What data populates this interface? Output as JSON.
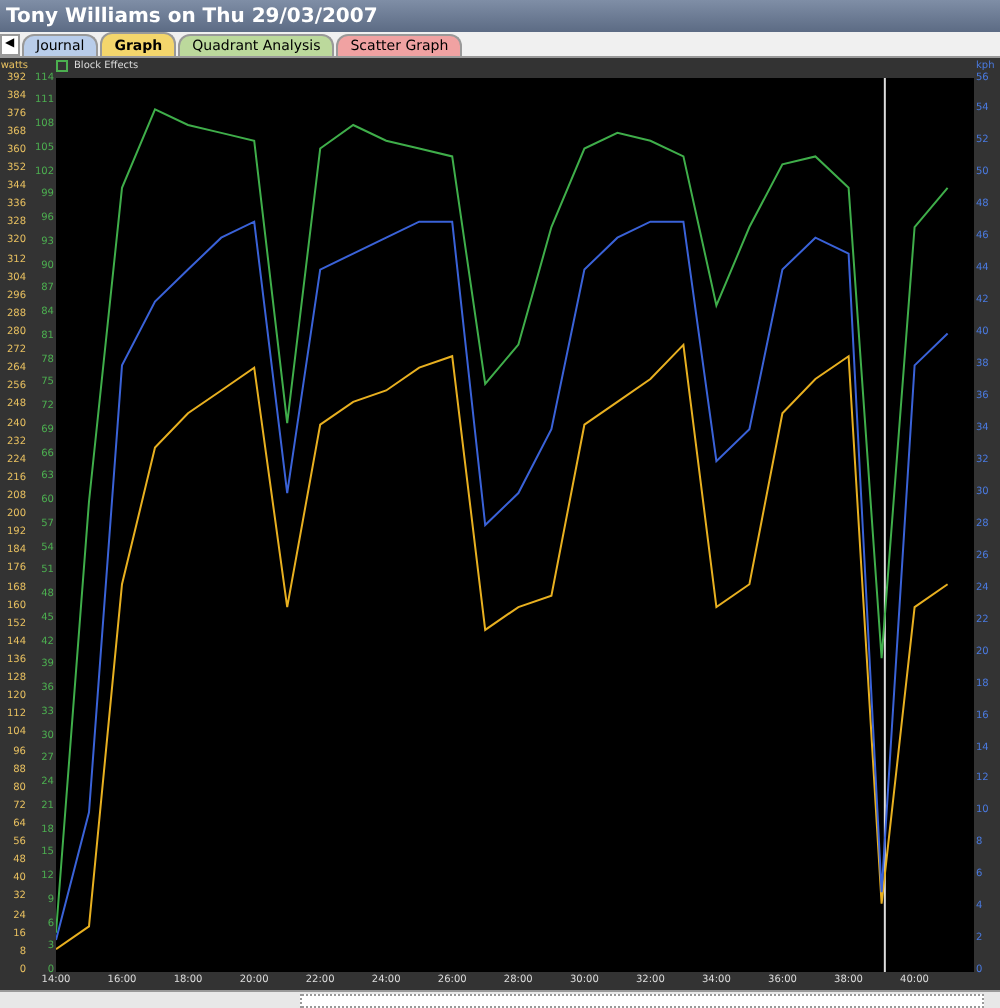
{
  "window": {
    "title": "Tony Williams on Thu 29/03/2007"
  },
  "nav_button": "◀",
  "tabs": [
    {
      "label": "Journal",
      "selected": false,
      "color": "#b9cdea"
    },
    {
      "label": "Graph",
      "selected": true,
      "color": "#f4d66c"
    },
    {
      "label": "Quadrant Analysis",
      "selected": false,
      "color": "#bcd99c"
    },
    {
      "label": "Scatter Graph",
      "selected": false,
      "color": "#f0a2a2"
    }
  ],
  "legend": {
    "label": "Block Effects"
  },
  "chart_data": {
    "type": "line",
    "ylabel": "watts",
    "y3label": "kph",
    "xlim": [
      14,
      41.8
    ],
    "ylim": [
      0,
      392
    ],
    "y2lim": [
      0,
      114
    ],
    "y3lim": [
      0,
      56
    ],
    "yticks": [
      392,
      384,
      376,
      368,
      360,
      352,
      344,
      336,
      328,
      320,
      312,
      304,
      296,
      288,
      280,
      272,
      264,
      256,
      248,
      240,
      232,
      224,
      216,
      208,
      200,
      192,
      184,
      176,
      168,
      160,
      152,
      144,
      136,
      128,
      120,
      112,
      104,
      96,
      88,
      80,
      72,
      64,
      56,
      48,
      40,
      32,
      24,
      16,
      8,
      0
    ],
    "y2ticks": [
      114,
      111,
      108,
      105,
      102,
      99,
      96,
      93,
      90,
      87,
      84,
      81,
      78,
      75,
      72,
      69,
      66,
      63,
      60,
      57,
      54,
      51,
      48,
      45,
      42,
      39,
      36,
      33,
      30,
      27,
      24,
      21,
      18,
      15,
      12,
      9,
      6,
      3,
      0
    ],
    "y3ticks": [
      56,
      54,
      52,
      50,
      48,
      46,
      44,
      42,
      40,
      38,
      36,
      34,
      32,
      30,
      28,
      26,
      24,
      22,
      20,
      18,
      16,
      14,
      12,
      10,
      8,
      6,
      4,
      2,
      0
    ],
    "ref_lines": [
      {
        "axis": "x",
        "value": 39.1,
        "color": "#dddddd"
      }
    ],
    "x": [
      14,
      15,
      16,
      17,
      18,
      19,
      20,
      21,
      22,
      23,
      24,
      25,
      26,
      27,
      28,
      29,
      30,
      31,
      32,
      33,
      34,
      35,
      36,
      37,
      38,
      39,
      40,
      41
    ],
    "xticks": [
      {
        "value": 14,
        "label": "14:00"
      },
      {
        "value": 16,
        "label": "16:00"
      },
      {
        "value": 18,
        "label": "18:00"
      },
      {
        "value": 20,
        "label": "20:00"
      },
      {
        "value": 22,
        "label": "22:00"
      },
      {
        "value": 24,
        "label": "24:00"
      },
      {
        "value": 26,
        "label": "26:00"
      },
      {
        "value": 28,
        "label": "28:00"
      },
      {
        "value": 30,
        "label": "30:00"
      },
      {
        "value": 32,
        "label": "32:00"
      },
      {
        "value": 34,
        "label": "34:00"
      },
      {
        "value": 36,
        "label": "36:00"
      },
      {
        "value": 38,
        "label": "38:00"
      },
      {
        "value": 40,
        "label": "40:00"
      }
    ],
    "series": [
      {
        "axis": "y",
        "color": "#e8b020",
        "values": [
          10,
          20,
          170,
          230,
          245,
          255,
          265,
          160,
          240,
          250,
          255,
          265,
          270,
          150,
          160,
          165,
          240,
          250,
          260,
          275,
          160,
          170,
          245,
          260,
          270,
          30,
          160,
          170
        ]
      },
      {
        "axis": "y2",
        "color": "#3fae4a",
        "values": [
          5,
          60,
          100,
          110,
          108,
          107,
          106,
          70,
          105,
          108,
          106,
          105,
          104,
          75,
          80,
          95,
          105,
          107,
          106,
          104,
          85,
          95,
          103,
          104,
          100,
          40,
          95,
          100
        ]
      },
      {
        "axis": "y3",
        "color": "#3a62d8",
        "values": [
          2,
          10,
          38,
          42,
          44,
          46,
          47,
          30,
          44,
          45,
          46,
          47,
          47,
          28,
          30,
          34,
          44,
          46,
          47,
          47,
          32,
          34,
          44,
          46,
          45,
          5,
          38,
          40
        ]
      }
    ]
  }
}
